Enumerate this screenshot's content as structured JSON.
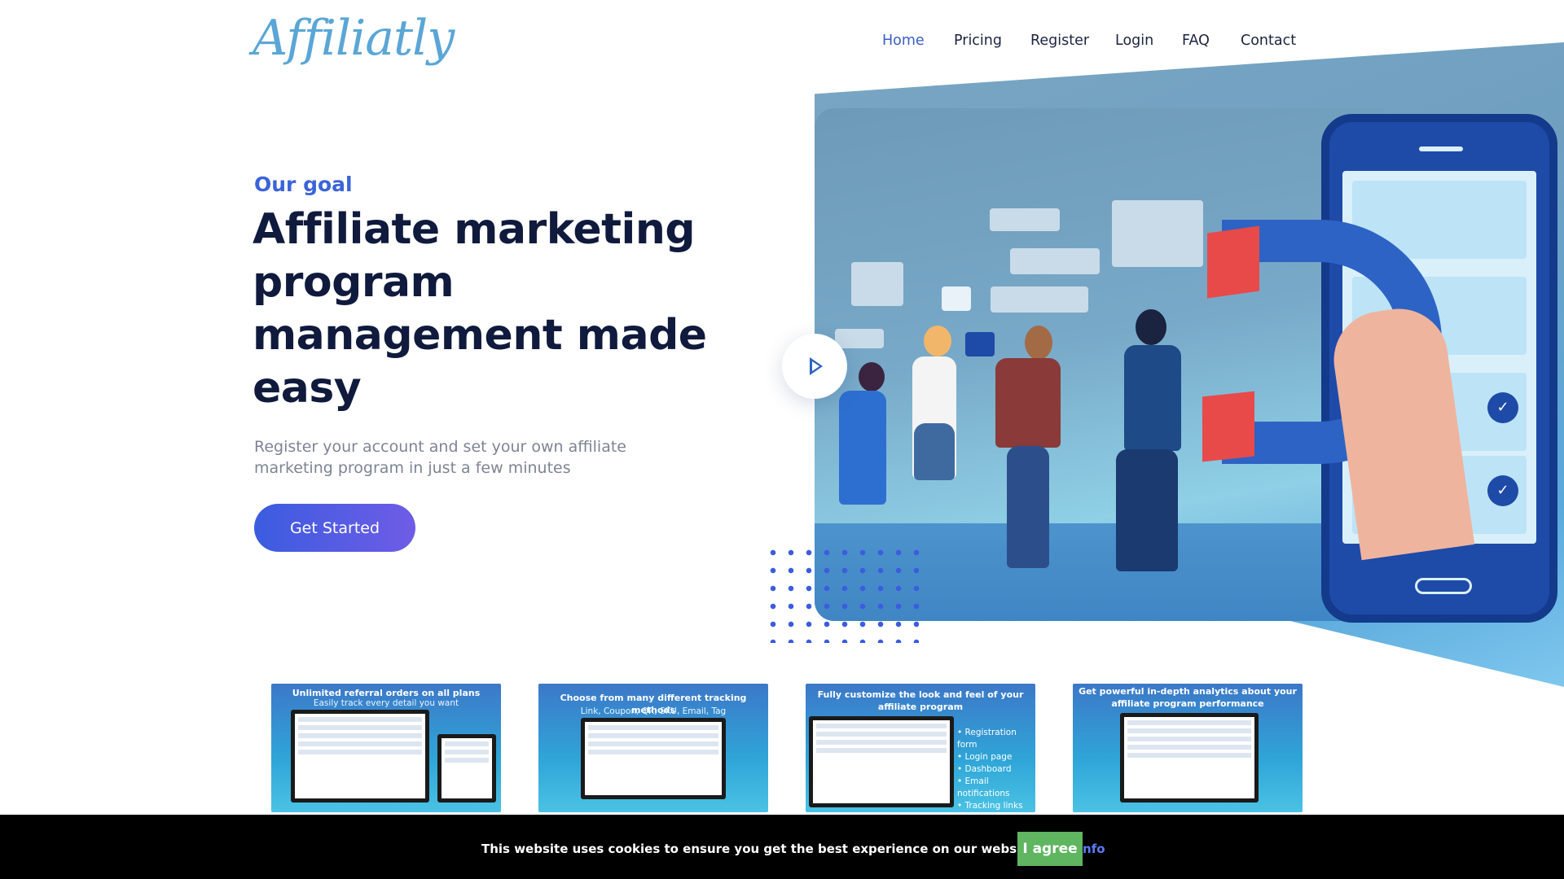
{
  "header": {
    "logo": "Affiliatly",
    "nav": {
      "home": "Home",
      "pricing": "Pricing",
      "register": "Register",
      "login": "Login",
      "faq": "FAQ",
      "contact": "Contact"
    }
  },
  "hero": {
    "eyebrow": "Our goal",
    "headline": "Affiliate marketing program management made easy",
    "subtext": "Register your account and set your own affiliate marketing program in just a few minutes",
    "cta_label": "Get Started"
  },
  "features": [
    {
      "title": "Unlimited referral orders on all plans",
      "subtitle": "Easily track every detail you want"
    },
    {
      "title": "Choose from many different tracking methods",
      "subtitle": "Link, Coupon, QR, SKU, Email, Tag"
    },
    {
      "title": "Fully customize the look and feel of your affiliate program",
      "list": [
        "Registration form",
        "Login page",
        "Dashboard",
        "Email notifications",
        "Tracking links"
      ]
    },
    {
      "title": "Get powerful in-depth analytics about your affiliate program performance"
    }
  ],
  "cookie": {
    "message": "This website uses cookies to ensure you get the best experience on our website",
    "more_info": "More info",
    "agree": "I agree"
  },
  "colors": {
    "accent": "#3b64d8",
    "cta_start": "#3b5ce0",
    "cta_end": "#6f5ce6",
    "heading": "#0f1a3d",
    "cookie_button": "#5fb560"
  }
}
